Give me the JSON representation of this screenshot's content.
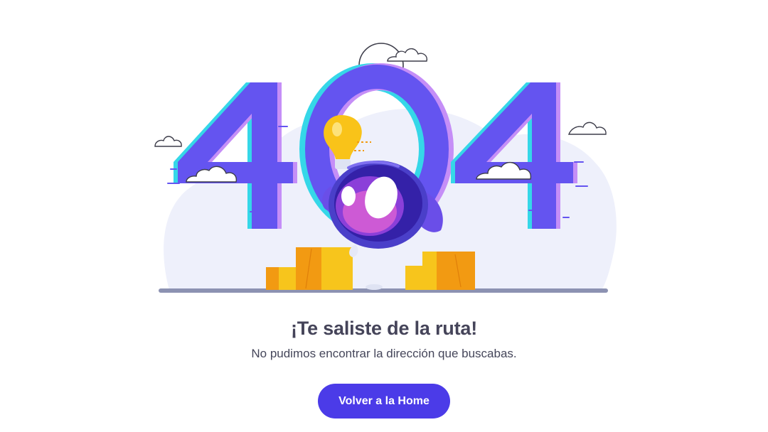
{
  "illustration": {
    "digits": [
      "4",
      "0",
      "4"
    ],
    "icons": [
      "cloud-icon",
      "lightbulb-icon",
      "robot-icon",
      "box-icon",
      "sun-icon"
    ]
  },
  "content": {
    "title": "¡Te saliste de la ruta!",
    "subtitle": "No pudimos encontrar la dirección que buscabas."
  },
  "actions": {
    "home_button_label": "Volver a la Home"
  },
  "colors": {
    "accent": "#4b3be8",
    "digit_purple": "#6454f0",
    "digit_cyan": "#35d7e8",
    "digit_pink": "#c58ef7",
    "box_orange": "#f29a12",
    "box_yellow": "#f7c51c",
    "text": "#454459"
  }
}
